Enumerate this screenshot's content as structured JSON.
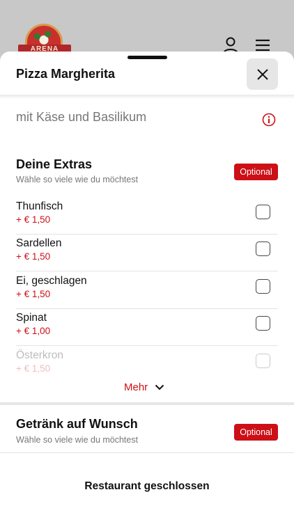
{
  "header": {
    "logo_text": "ARENA",
    "user_icon": "user-icon",
    "menu_icon": "menu-icon"
  },
  "sheet": {
    "title": "Pizza Margherita",
    "close_icon": "close-icon",
    "description": "mit Käse und Basilikum",
    "info_icon": "info-icon"
  },
  "extras": {
    "title": "Deine Extras",
    "subtitle": "Wähle so viele wie du möchtest",
    "badge": "Optional",
    "items": [
      {
        "name": "Thunfisch",
        "price": "+ € 1,50",
        "checked": false
      },
      {
        "name": "Sardellen",
        "price": "+ € 1,50",
        "checked": false
      },
      {
        "name": "Ei, geschlagen",
        "price": "+ € 1,50",
        "checked": false
      },
      {
        "name": "Spinat",
        "price": "+ € 1,00",
        "checked": false
      },
      {
        "name": "Österkron",
        "price": "+ € 1,50",
        "checked": false
      }
    ],
    "more_label": "Mehr",
    "more_icon": "chevron-down-icon"
  },
  "drink": {
    "title": "Getränk auf Wunsch",
    "subtitle": "Wähle so viele wie du möchtest",
    "badge": "Optional"
  },
  "footer": {
    "status": "Restaurant geschlossen"
  },
  "colors": {
    "accent": "#cc1016",
    "muted_text": "#777777",
    "close_button_bg": "#e6e6e6"
  }
}
